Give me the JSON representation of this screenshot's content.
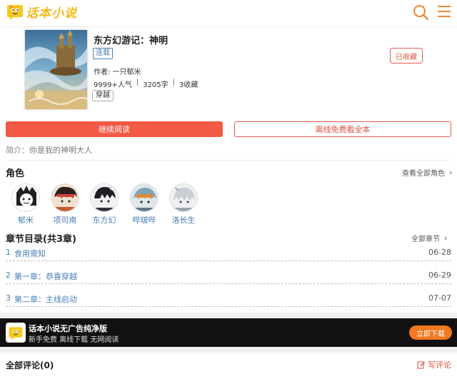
{
  "header": {
    "logo_text": "话本小说",
    "search_icon": "search-icon",
    "menu_icon": "menu-icon",
    "brand_color": "#f2781d"
  },
  "book": {
    "title": "东方幻游记：神明",
    "status": "连载",
    "author": "作者: 一只郁米",
    "popularity": "9999+人气",
    "word_count": "3205字",
    "favorites": "3收藏",
    "genre": "穿越",
    "fav_button": "已收藏"
  },
  "actions": {
    "continue_read": "继续阅读",
    "offline_read": "离线免费看全本"
  },
  "intro": {
    "label": "简介：",
    "text": "你是我的神明大人"
  },
  "roles": {
    "title": "角色",
    "more": "查看全部角色",
    "items": [
      {
        "name": "郁米"
      },
      {
        "name": "项司南"
      },
      {
        "name": "东方幻"
      },
      {
        "name": "哔啵哔"
      },
      {
        "name": "洛长生"
      }
    ]
  },
  "chapters": {
    "title": "章节目录(共3章)",
    "more": "全部章节",
    "items": [
      {
        "num": "1",
        "title": "食用需知",
        "date": "06-28"
      },
      {
        "num": "2",
        "title": "第一章：恭喜穿越",
        "date": "06-29"
      },
      {
        "num": "3",
        "title": "第二章：主线启动",
        "date": "07-07"
      }
    ]
  },
  "banner": {
    "title": "话本小说无广告纯净版",
    "subtitle": "新手免费 离线下载 无网阅读",
    "button": "立即下载"
  },
  "comments": {
    "title": "全部评论(0)",
    "write": "写评论"
  },
  "colors": {
    "accent_red": "#f25a45",
    "link_blue": "#4a7db5",
    "download_orange": "#f2781d"
  }
}
